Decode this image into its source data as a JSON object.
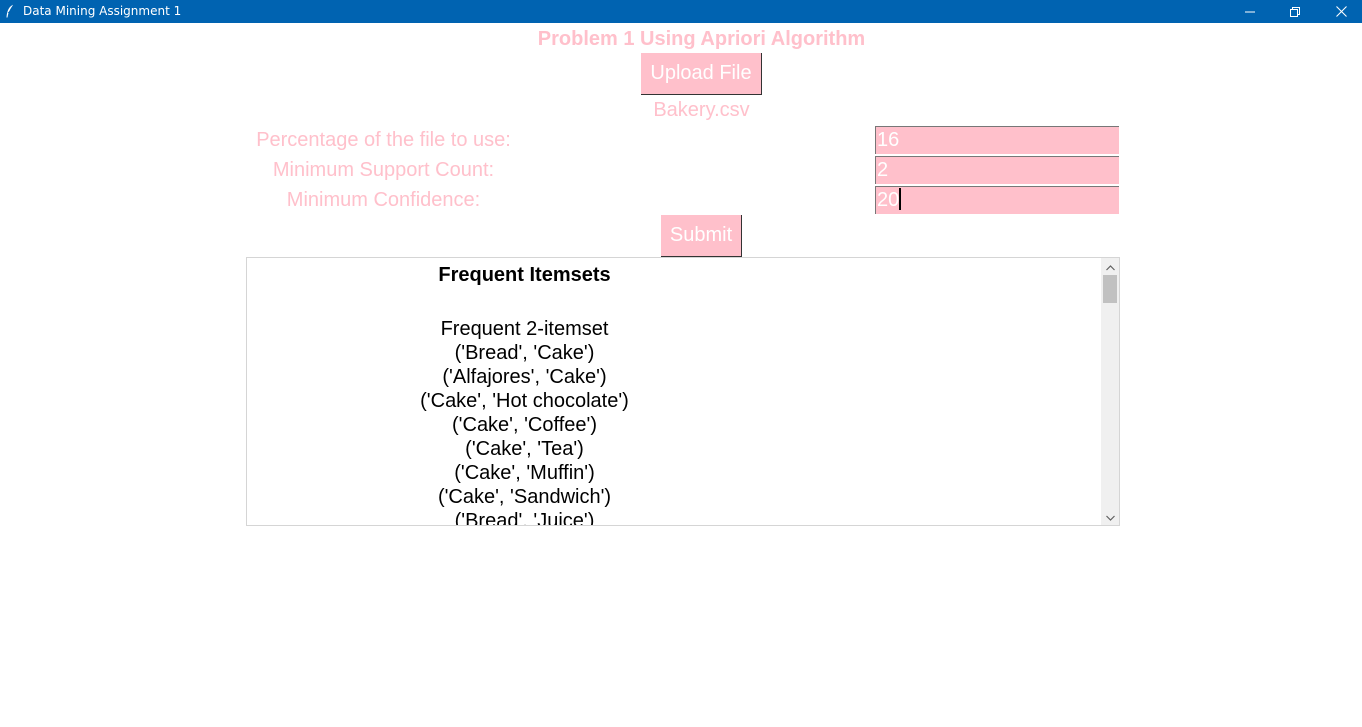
{
  "window": {
    "title": "Data Mining Assignment 1",
    "icon": "feather-icon",
    "controls": [
      "minimize-icon",
      "restore-icon",
      "close-icon"
    ]
  },
  "colors": {
    "titlebar": "#0063b1",
    "accent": "#ffc0cb",
    "button_text": "#ffffff"
  },
  "heading": "Problem 1 Using Apriori Algorithm",
  "upload": {
    "button_label": "Upload File",
    "file_name": "Bakery.csv"
  },
  "fields": [
    {
      "label": "Percentage of the file to use:",
      "value": "16"
    },
    {
      "label": "Minimum Support Count:",
      "value": "2"
    },
    {
      "label": "Minimum Confidence:",
      "value": "20"
    }
  ],
  "submit_label": "Submit",
  "results": {
    "heading": "Frequent Itemsets",
    "section_title": "Frequent 2-itemset",
    "items": [
      "('Bread', 'Cake')",
      "('Alfajores', 'Cake')",
      "('Cake', 'Hot chocolate')",
      "('Cake', 'Coffee')",
      "('Cake', 'Tea')",
      "('Cake', 'Muffin')",
      "('Cake', 'Sandwich')",
      "('Bread', 'Juice')"
    ]
  }
}
